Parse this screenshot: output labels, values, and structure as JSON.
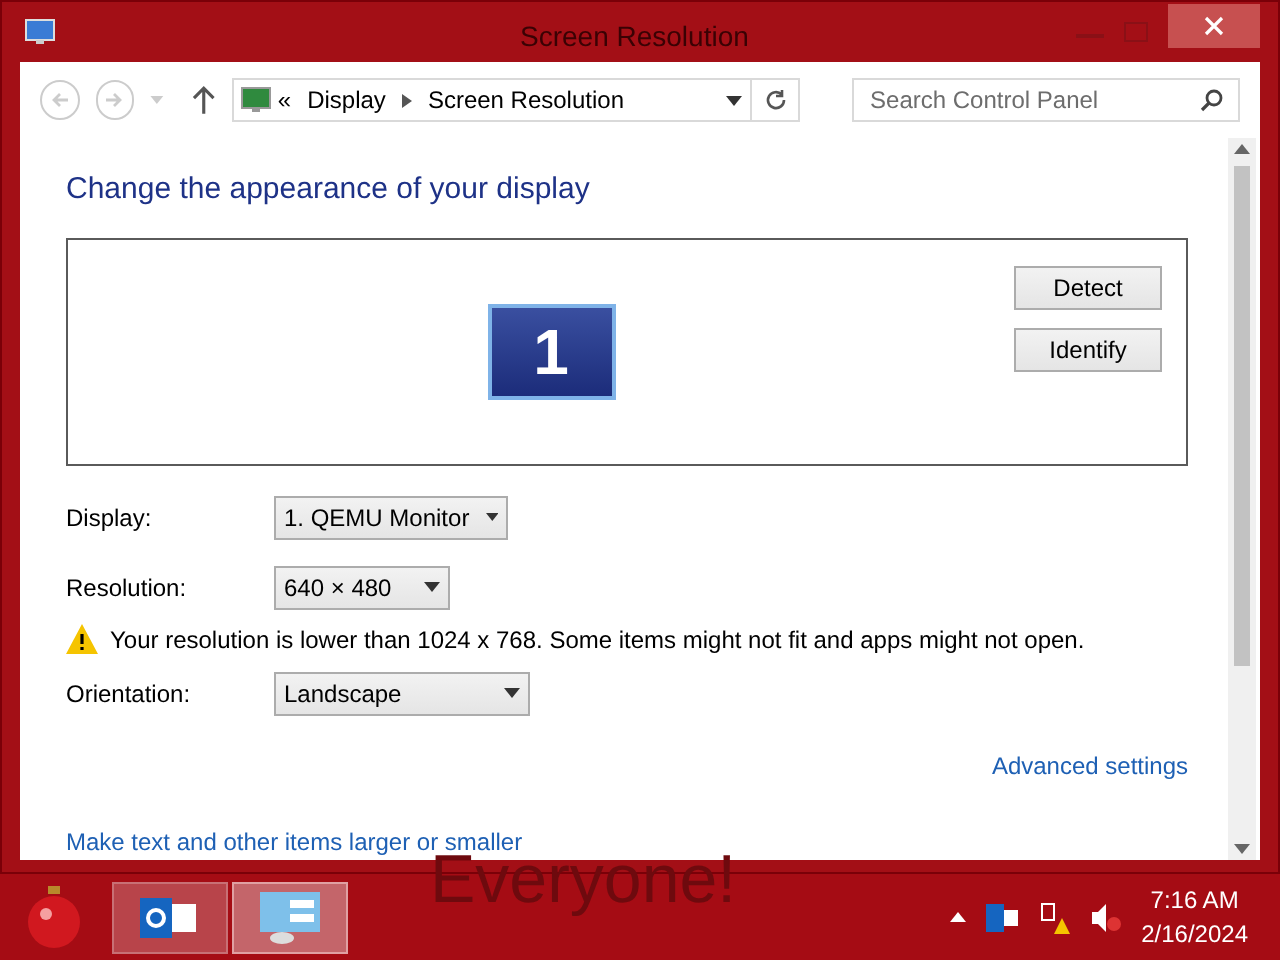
{
  "window": {
    "title": "Screen Resolution"
  },
  "address_bar": {
    "overflow": "«",
    "crumbs": [
      "Display",
      "Screen Resolution"
    ]
  },
  "search": {
    "placeholder": "Search Control Panel"
  },
  "heading": "Change the appearance of your display",
  "monitor": {
    "number": "1"
  },
  "buttons": [
    "Detect",
    "Identify"
  ],
  "fields": [
    {
      "label": "Display:",
      "value": "1. QEMU Monitor"
    },
    {
      "label": "Resolution:",
      "value": "640 × 480"
    }
  ],
  "warning": "Your resolution is lower than 1024 x 768. Some items might not fit and apps might not open.",
  "orientation": {
    "label": "Orientation:",
    "value": "Landscape"
  },
  "links": [
    "Advanced settings",
    "Make text and other items larger or smaller"
  ],
  "taskbar": {
    "wallpaper_text": "Everyone!",
    "apps": [
      {
        "selected": false
      },
      {
        "selected": true
      }
    ],
    "time": "7:16 AM",
    "date": "2/16/2024"
  }
}
